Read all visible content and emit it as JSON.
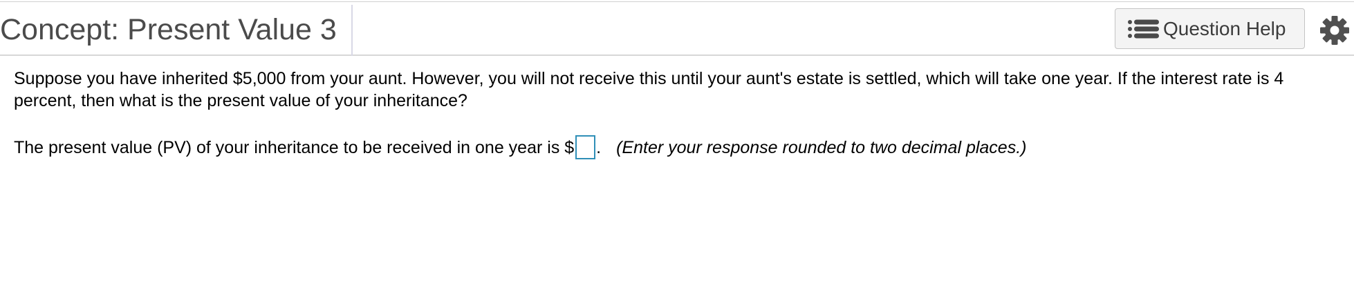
{
  "header": {
    "title": "Concept: Present Value 3",
    "help_button_label": "Question Help",
    "help_icon": "list-icon",
    "settings_icon": "gear-icon"
  },
  "question": {
    "text": "Suppose you have inherited $5,000 from your aunt.  However, you will not receive this until your aunt's estate is settled, which will take one year.  If the interest rate is 4 percent, then what is the present value of your inheritance?"
  },
  "answer": {
    "prompt": "The present value (PV) of your inheritance to be received in one year is $",
    "value": "",
    "after": ".",
    "hint": "(Enter your response rounded to two decimal places.)"
  },
  "colors": {
    "input_border": "#2f8fb7",
    "title_text": "#4b4b4b",
    "button_bg": "#f4f4f4"
  }
}
